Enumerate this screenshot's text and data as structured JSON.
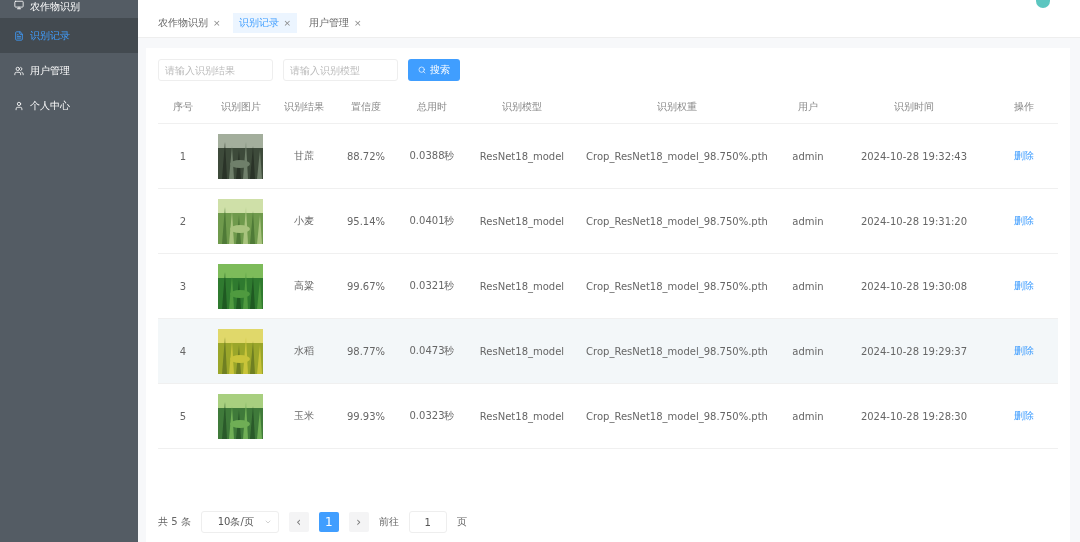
{
  "sidebar": {
    "items": [
      {
        "label": "农作物识别",
        "selected": false
      },
      {
        "label": "识别记录",
        "selected": true
      },
      {
        "label": "用户管理",
        "selected": false
      },
      {
        "label": "个人中心",
        "selected": false
      }
    ]
  },
  "tabs": [
    {
      "label": "农作物识别",
      "selected": false,
      "close": "×"
    },
    {
      "label": "识别记录",
      "selected": true,
      "close": "×"
    },
    {
      "label": "用户管理",
      "selected": false,
      "close": "×"
    }
  ],
  "search": {
    "fields": [
      {
        "placeholder": "请输入识别结果"
      },
      {
        "placeholder": "请输入识别模型"
      }
    ],
    "button": "搜索"
  },
  "table": {
    "columns": [
      "序号",
      "识别图片",
      "识别结果",
      "置信度",
      "总用时",
      "识别模型",
      "识别权重",
      "用户",
      "识别时间",
      "操作"
    ],
    "rows": [
      {
        "index": "1",
        "result": "甘蔗",
        "confidence": "88.72%",
        "time_used": "0.0388秒",
        "model": "ResNet18_model",
        "weights": "Crop_ResNet18_model_98.750%.pth",
        "user": "admin",
        "time": "2024-10-28 19:32:43",
        "action": "删除",
        "selected": false
      },
      {
        "index": "2",
        "result": "小麦",
        "confidence": "95.14%",
        "time_used": "0.0401秒",
        "model": "ResNet18_model",
        "weights": "Crop_ResNet18_model_98.750%.pth",
        "user": "admin",
        "time": "2024-10-28 19:31:20",
        "action": "删除",
        "selected": false
      },
      {
        "index": "3",
        "result": "高粱",
        "confidence": "99.67%",
        "time_used": "0.0321秒",
        "model": "ResNet18_model",
        "weights": "Crop_ResNet18_model_98.750%.pth",
        "user": "admin",
        "time": "2024-10-28 19:30:08",
        "action": "删除",
        "selected": false
      },
      {
        "index": "4",
        "result": "水稻",
        "confidence": "98.77%",
        "time_used": "0.0473秒",
        "model": "ResNet18_model",
        "weights": "Crop_ResNet18_model_98.750%.pth",
        "user": "admin",
        "time": "2024-10-28 19:29:37",
        "action": "删除",
        "selected": true
      },
      {
        "index": "5",
        "result": "玉米",
        "confidence": "99.93%",
        "time_used": "0.0323秒",
        "model": "ResNet18_model",
        "weights": "Crop_ResNet18_model_98.750%.pth",
        "user": "admin",
        "time": "2024-10-28 19:28:30",
        "action": "删除",
        "selected": false
      }
    ]
  },
  "pagination": {
    "total": "共 5 条",
    "page_size": "10条/页",
    "prev": "‹",
    "pages": [
      {
        "label": "1",
        "selected": true
      }
    ],
    "next": "›",
    "goto_label": "前往",
    "goto_value": "1",
    "goto_suffix": "页"
  }
}
